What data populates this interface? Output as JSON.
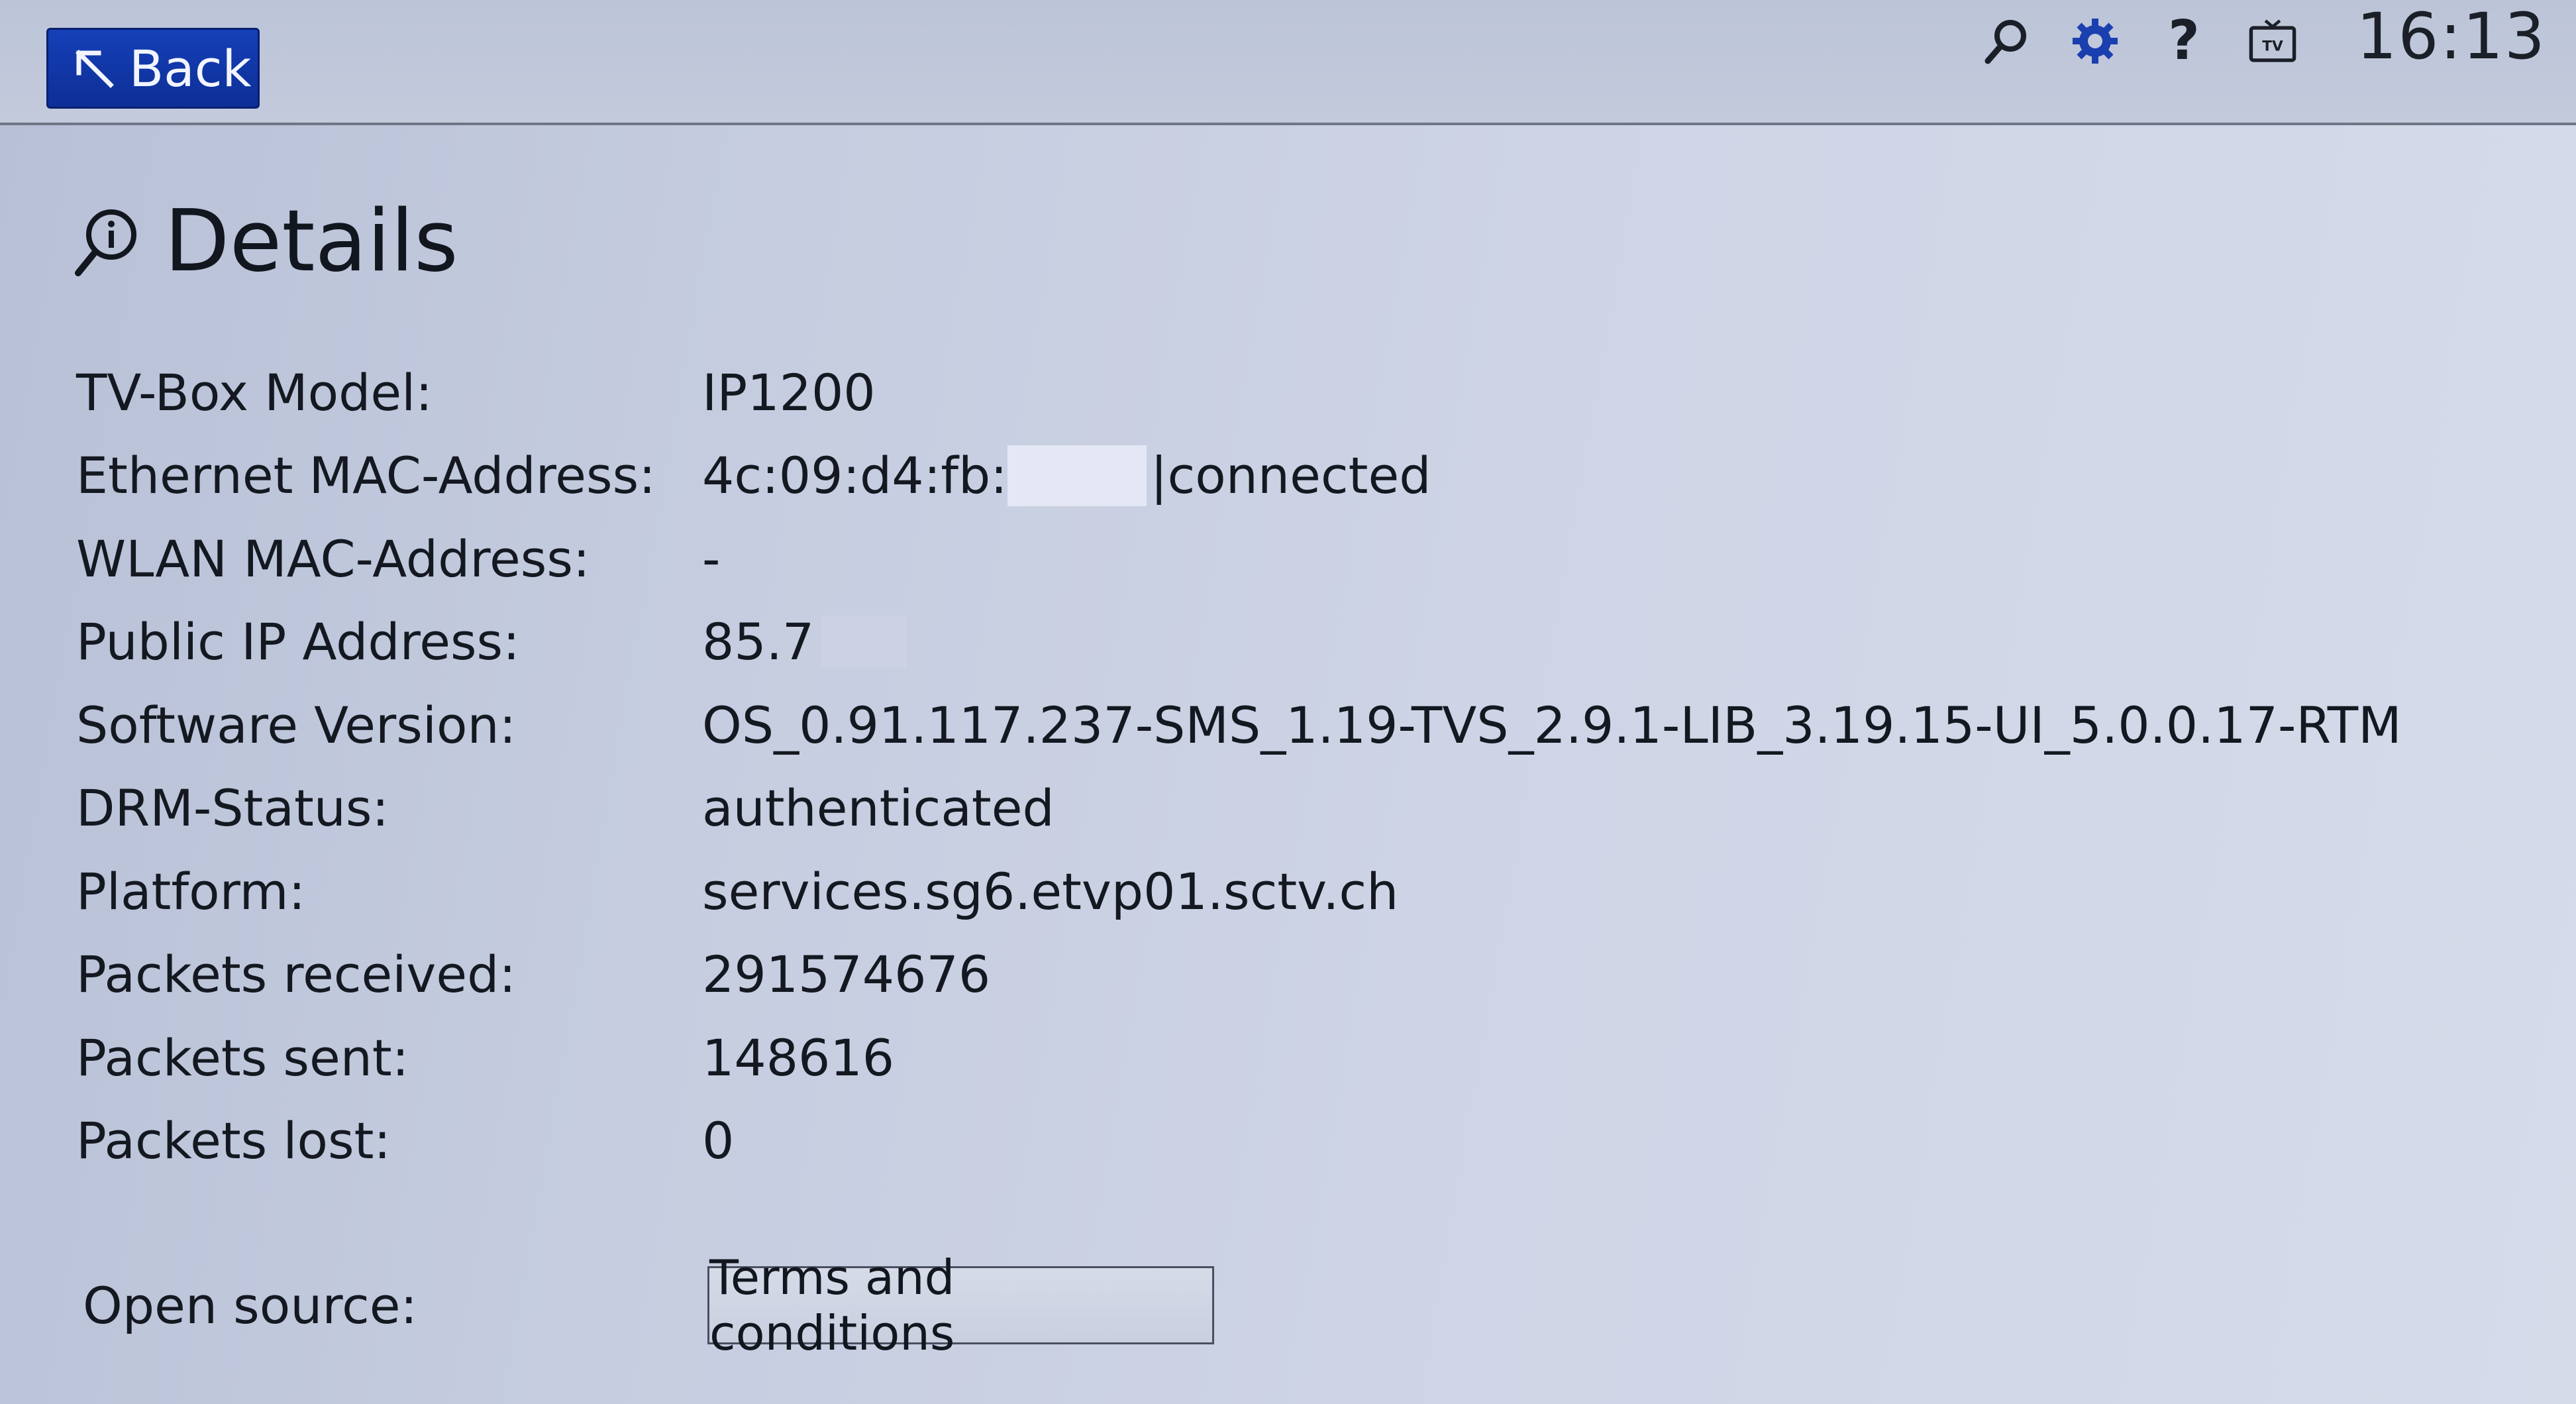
{
  "header": {
    "back_label": "Back",
    "clock": "16:13",
    "icons": [
      "search-icon",
      "gear-icon",
      "help-icon",
      "tv-icon"
    ],
    "help_glyph": "?",
    "tv_label": "TV",
    "accent_color": "#0d2e96",
    "gear_color": "#1a3fae"
  },
  "page": {
    "title": "Details",
    "title_icon": "info-search-icon"
  },
  "details": [
    {
      "label": "TV-Box Model:",
      "value": "IP1200"
    },
    {
      "label": "Ethernet MAC-Address:",
      "value": "4c:09:d4:fb:",
      "suffix": "|connected"
    },
    {
      "label": "WLAN MAC-Address:",
      "value": "-"
    },
    {
      "label": "Public IP Address:",
      "value": "85.7"
    },
    {
      "label": "Software Version:",
      "value": "OS_0.91.117.237-SMS_1.19-TVS_2.9.1-LIB_3.19.15-UI_5.0.0.17-RTM"
    },
    {
      "label": "DRM-Status:",
      "value": "authenticated"
    },
    {
      "label": "Platform:",
      "value": "services.sg6.etvp01.sctv.ch"
    },
    {
      "label": "Packets received:",
      "value": "291574676"
    },
    {
      "label": "Packets sent:",
      "value": "148616"
    },
    {
      "label": "Packets lost:",
      "value": "0"
    }
  ],
  "open_source": {
    "label": "Open source:",
    "button_label": "Terms and conditions"
  }
}
